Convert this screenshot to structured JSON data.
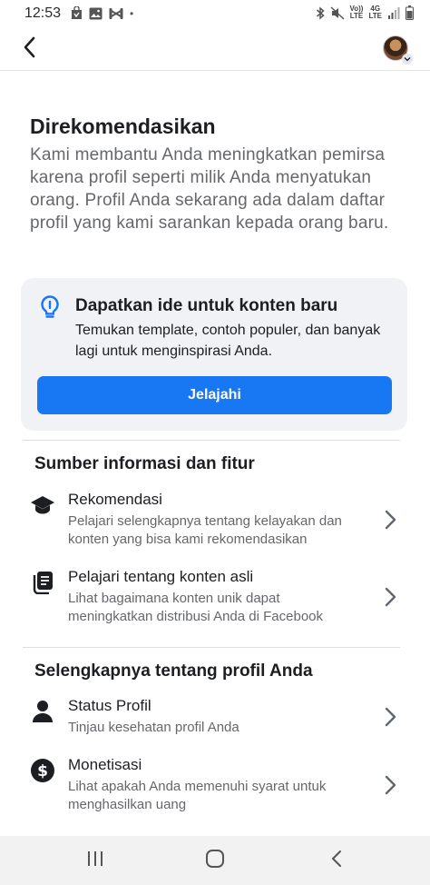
{
  "status_bar": {
    "time": "12:53",
    "dot": "•",
    "volte_line1": "Vo))",
    "volte_line2": "LTE",
    "network_line1": "4G",
    "network_line2": "LTE",
    "icons_left": [
      "snapchat-bag-icon",
      "image-icon",
      "capcut-icon"
    ],
    "icons_right": [
      "bluetooth-icon",
      "mute-icon",
      "signal-icon",
      "battery-icon"
    ]
  },
  "header": {
    "back_icon": "back-arrow-icon"
  },
  "recommended": {
    "title": "Direkomendasikan",
    "description": "Kami membantu Anda meningkatkan pemirsa karena profil seperti milik Anda menyatukan orang. Profil Anda sekarang ada dalam daftar profil yang kami sarankan kepada orang baru."
  },
  "idea_card": {
    "icon": "lightbulb-icon",
    "title": "Dapatkan ide untuk konten baru",
    "description": "Temukan template, contoh populer, dan banyak lagi untuk menginspirasi Anda.",
    "button_label": "Jelajahi",
    "button_color": "#1877f2"
  },
  "sources": {
    "title": "Sumber informasi dan fitur",
    "items": [
      {
        "icon": "graduation-cap-icon",
        "title": "Rekomendasi",
        "description": "Pelajari selengkapnya tentang kelayakan dan konten yang bisa kami rekomendasikan"
      },
      {
        "icon": "original-content-icon",
        "title": "Pelajari tentang konten asli",
        "description": "Lihat bagaimana konten unik dapat meningkatkan distribusi Anda di Facebook"
      }
    ]
  },
  "profile_more": {
    "title": "Selengkapnya tentang profil Anda",
    "items": [
      {
        "icon": "person-icon",
        "title": "Status Profil",
        "description": "Tinjau kesehatan profil Anda"
      },
      {
        "icon": "dollar-icon",
        "title": "Monetisasi",
        "description": "Lihat apakah Anda memenuhi syarat untuk menghasilkan uang"
      }
    ]
  },
  "nav_bar": {
    "buttons": [
      "recent-apps-icon",
      "home-icon",
      "back-nav-icon"
    ]
  }
}
